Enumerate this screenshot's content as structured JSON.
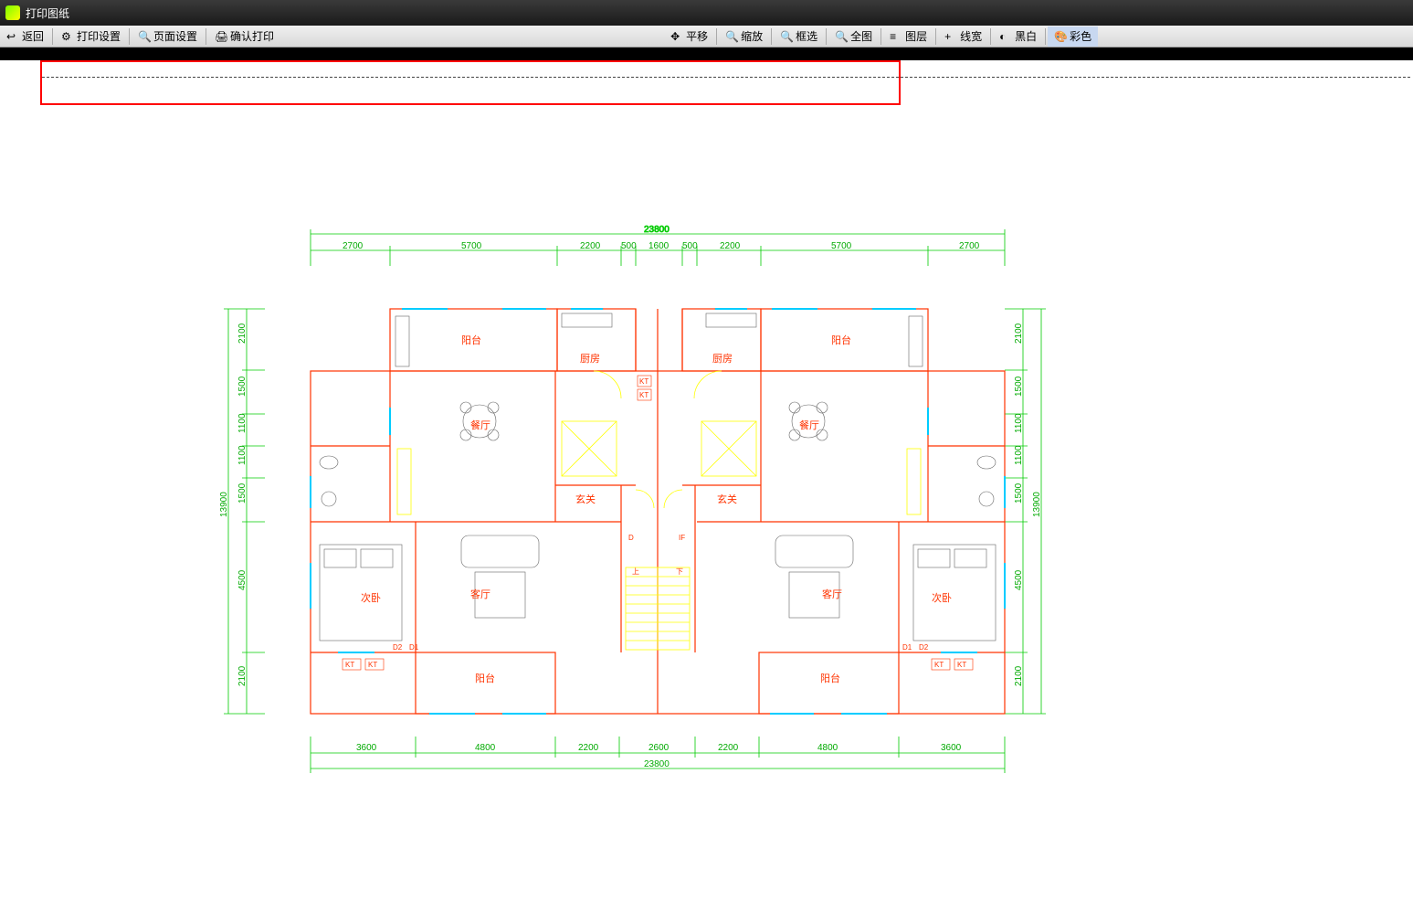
{
  "window": {
    "title": "打印图纸"
  },
  "toolbar_left": [
    {
      "label": "返回",
      "icon": "back"
    },
    {
      "label": "打印设置",
      "icon": "gear"
    },
    {
      "label": "页面设置",
      "icon": "zoom"
    },
    {
      "label": "确认打印",
      "icon": "print"
    }
  ],
  "toolbar_right": [
    {
      "label": "平移",
      "icon": "pan"
    },
    {
      "label": "缩放",
      "icon": "zoom"
    },
    {
      "label": "框选",
      "icon": "zoom"
    },
    {
      "label": "全图",
      "icon": "zoom"
    },
    {
      "label": "图层",
      "icon": "layers"
    },
    {
      "label": "线宽",
      "icon": "plus"
    },
    {
      "label": "黑白",
      "icon": "bw"
    },
    {
      "label": "彩色",
      "icon": "color"
    }
  ],
  "dims_top_total": "23800",
  "dims_top": [
    "2700",
    "5700",
    "2200",
    "500",
    "1600",
    "500",
    "2200",
    "5700",
    "2700"
  ],
  "dims_bottom_total": "23800",
  "dims_bottom": [
    "3600",
    "4800",
    "2200",
    "2600",
    "2200",
    "4800",
    "3600"
  ],
  "dims_left_total": "13900",
  "dims_left": [
    "2100",
    "1500",
    "1100",
    "1100",
    "1500",
    "4500",
    "2100"
  ],
  "dims_right_total": "13900",
  "dims_right": [
    "2100",
    "1500",
    "1100",
    "1100",
    "1500",
    "4500",
    "2100"
  ],
  "rooms": {
    "balcony_tl": "阳台",
    "balcony_tr": "阳台",
    "kitchen_l": "厨房",
    "kitchen_r": "厨房",
    "dining_l": "餐厅",
    "dining_r": "餐厅",
    "entry_l": "玄关",
    "entry_r": "玄关",
    "living_l": "客厅",
    "living_r": "客厅",
    "bed_l": "次卧",
    "bed_r": "次卧",
    "balcony_bl": "阳台",
    "balcony_br": "阳台",
    "kt_l": "KT",
    "kt_r": "KT",
    "d_l": "D",
    "if_r": "IF",
    "up": "上",
    "down": "下",
    "d1_l": "D1",
    "d2_l": "D2",
    "d1_r": "D1",
    "d2_r": "D2",
    "kt_bl1": "KT",
    "kt_bl2": "KT",
    "kt_br1": "KT",
    "kt_br2": "KT"
  }
}
